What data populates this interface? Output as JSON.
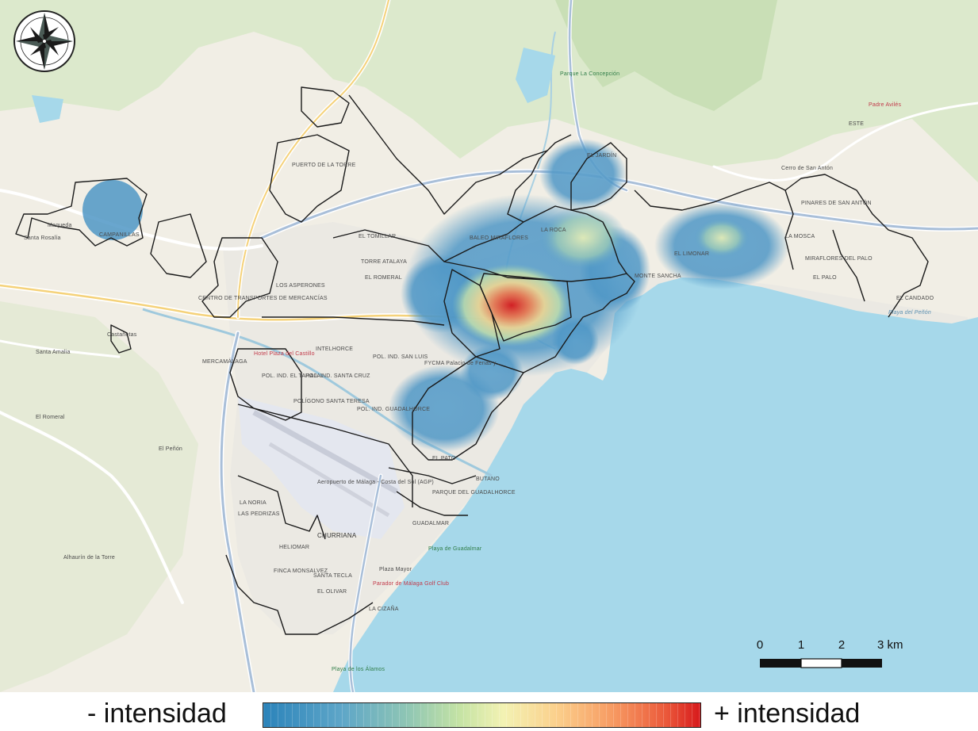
{
  "map": {
    "compass": "compass-rose-icon",
    "scale_bar": {
      "ticks": [
        "0",
        "1",
        "2",
        "3 km"
      ]
    },
    "colors": {
      "sea": "#a6d8ea",
      "land": "#f2efe6",
      "urban": "#ebebeb",
      "vegetation": "#d8e8c9",
      "boundary": "#1a1a1a",
      "heat_low": "#2b83ba",
      "heat_high": "#d7191c"
    },
    "labels": {
      "este": "ESTE",
      "maqueda": "Maqueda",
      "santa_rosalia": "Santa Rosalía",
      "campanillas": "CAMPANILLAS",
      "santa_amalia": "Santa Amalia",
      "castanetas": "Castañetas",
      "el_romeral_w": "El Romeral",
      "el_penon": "El Peñón",
      "alhaurin": "Alhaurín de la Torre",
      "puerto_torre": "PUERTO DE LA TORRE",
      "el_tomillar": "EL TOMILLAR",
      "torre_atalaya": "TORRE ATALAYA",
      "los_asperones": "LOS ASPERONES",
      "el_romeral": "EL ROMERAL",
      "centro_transportes": "CENTRO DE TRANSPORTES DE MERCANCÍAS",
      "intelhorce": "INTELHORCE",
      "pol_san_luis": "POL. IND. SAN LUIS",
      "mercamalaga": "MERCAMÁLAGA",
      "el_tarajal": "POL. IND. EL TARAJAL",
      "santa_cruz": "POL. IND. SANTA CRUZ",
      "santa_teresa": "POLÍGONO SANTA TERESA",
      "guadalhorce": "POL. IND. GUADALHORCE",
      "aeropuerto": "Aeropuerto de Málaga - Costa del Sol (AGP)",
      "churriana": "CHURRIANA",
      "la_noria": "LA NORIA",
      "las_pedrizas": "LAS PEDRIZAS",
      "heliomar": "HELIOMAR",
      "finca_monsalvez": "FINCA MONSALVEZ",
      "santa_tecla": "SANTA TECLA",
      "el_olivar": "EL OLIVAR",
      "la_cizana": "LA CIZAÑA",
      "guadalmar": "GUADALMAR",
      "parque_guadalhorce": "PARQUE DEL GUADALHORCE",
      "butano": "BUTANO",
      "el_pato": "EL PATO",
      "baleo_miraflores": "BALEO MIRAFLORES",
      "la_roca": "LA ROCA",
      "el_jardin": "EL JARDÍN",
      "monte_sancha": "MONTE SANCHA",
      "el_limonar": "EL LIMONAR",
      "pinares": "PINARES DE SAN ANTÓN",
      "miraflores_palo": "MIRAFLORES DEL PALO",
      "el_palo": "EL PALO",
      "candado": "EL CANDADO",
      "la_mosca": "LA MOSCA",
      "playa_penon": "Playa del Peñón",
      "playa_guadalmar": "Playa de Guadalmar",
      "playa_alamos": "Playa de los Álamos",
      "parque_concepcion": "Parque La Concepción",
      "hotel_castillo": "Hotel Plaza del Castillo",
      "cerro_anton": "Cerro de San Antón",
      "padre_aviles": "Padre Avilés",
      "fycma": "FYCMA Palacio de Ferias y...",
      "plaza_mayor": "Plaza Mayor",
      "parador": "Parador de Málaga Golf Club"
    }
  },
  "legend": {
    "min_label": "- intensidad",
    "max_label": "+ intensidad"
  }
}
